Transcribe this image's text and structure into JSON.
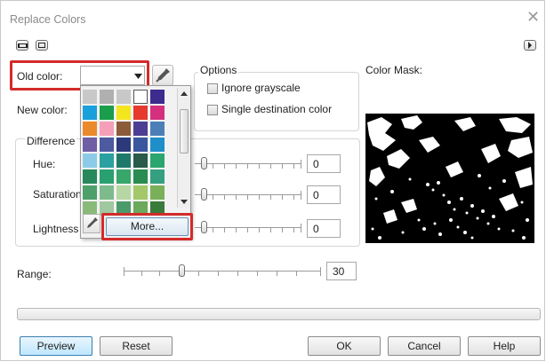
{
  "dialog": {
    "title": "Replace Colors",
    "close_glyph": "✕"
  },
  "old_color": {
    "label": "Old color:",
    "value": ""
  },
  "new_color": {
    "label": "New color:"
  },
  "options": {
    "title": "Options",
    "ignore_grayscale": {
      "label": "Ignore grayscale",
      "checked": false
    },
    "single_destination": {
      "label": "Single destination color",
      "checked": false
    }
  },
  "differences": {
    "title": "Difference",
    "hue": {
      "label": "Hue:",
      "value": "0"
    },
    "saturation": {
      "label": "Saturation",
      "value": "0"
    },
    "lightness": {
      "label": "Lightness",
      "value": "0"
    }
  },
  "color_mask": {
    "label": "Color Mask:"
  },
  "range": {
    "label": "Range:",
    "value": "30"
  },
  "palette": {
    "more_label": "More...",
    "colors": [
      "#c8c8c8",
      "#b0b0b0",
      "#c8c8c8",
      "#ffffff",
      "#3d2b8e",
      "#1aa0db",
      "#1a9e4c",
      "#f3e61e",
      "#e63a2e",
      "#d4307f",
      "#eb8a2b",
      "#f59fb8",
      "#8c5c3a",
      "#4d3e93",
      "#4c7fb7",
      "#6f5ea4",
      "#4c5aa0",
      "#2c3a7c",
      "#3a58a0",
      "#1e8fc9",
      "#8ccbe8",
      "#2ba0a0",
      "#1d7a6b",
      "#2a5a4a",
      "#2aa66e",
      "#27885c",
      "#2aa070",
      "#37a76a",
      "#2a8c50",
      "#35a080",
      "#4ea06a",
      "#7dbb8c",
      "#b6d7a4",
      "#a2c86a",
      "#7ab05a",
      "#8aba7a",
      "#a0c8a0",
      "#4a9a6a",
      "#6aaa5a",
      "#3a7a3a"
    ]
  },
  "buttons": {
    "preview": "Preview",
    "reset": "Reset",
    "ok": "OK",
    "cancel": "Cancel",
    "help": "Help"
  }
}
